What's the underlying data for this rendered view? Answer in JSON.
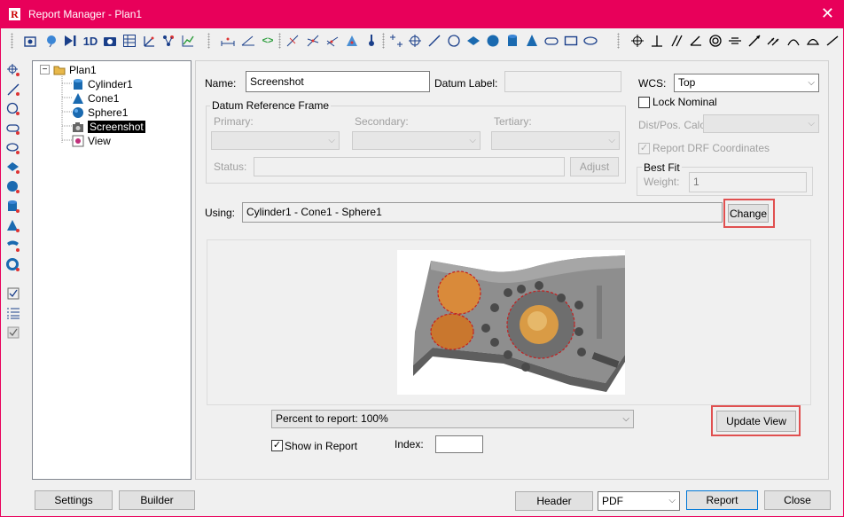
{
  "window": {
    "title": "Report Manager - Plan1",
    "close_glyph": "✕"
  },
  "toolbar": {
    "icons": [
      "screenshot-icon",
      "balloon-icon",
      "play-next-icon",
      "one-d-icon",
      "camera-icon",
      "table-icon",
      "axis-icon",
      "nodes-icon",
      "chart-axis-icon",
      "dimension-icon",
      "angle-icon",
      "code-icon",
      "tangent-icon",
      "intersect-icon",
      "midline-icon",
      "cone-point-icon",
      "probe-icon",
      "points-icon",
      "target-icon",
      "line-icon",
      "circle-icon",
      "plane-icon",
      "sphere-icon",
      "cylinder-icon",
      "cone-icon",
      "slot-icon",
      "rectangle-icon",
      "ellipse-icon",
      "position-icon",
      "perpendicular-icon",
      "parallel-icon",
      "angularity-icon",
      "concentricity-icon",
      "symmetry-icon",
      "runout-icon",
      "total-runout-icon",
      "profile-line-icon",
      "profile-surface-icon",
      "flatness-icon"
    ],
    "one_d_label": "1D"
  },
  "left_toolbar": {
    "icons": [
      "point-tool-icon",
      "line-tool-icon",
      "circle-tool-icon",
      "ellipse-tool-icon",
      "slot-tool-icon",
      "plane-tool-icon",
      "sphere-tool-icon",
      "cylinder-tool-icon",
      "cone-tool-icon",
      "surface-tool-icon",
      "torus-tool-icon",
      "checklist-icon",
      "list-icon",
      "report-check-icon"
    ]
  },
  "tree": {
    "root": "Plan1",
    "items": [
      {
        "label": "Cylinder1",
        "icon": "cylinder-icon"
      },
      {
        "label": "Cone1",
        "icon": "cone-icon"
      },
      {
        "label": "Sphere1",
        "icon": "sphere-icon"
      },
      {
        "label": "Screenshot",
        "icon": "camera-icon",
        "selected": true
      },
      {
        "label": "View",
        "icon": "view-icon"
      }
    ],
    "collapse_glyph": "−"
  },
  "form": {
    "name_label": "Name:",
    "name_value": "Screenshot",
    "datum_label": "Datum Label:",
    "datum_value": "",
    "wcs_label": "WCS:",
    "wcs_value": "Top",
    "lock_nominal": "Lock Nominal",
    "dist_pos_calc": "Dist/Pos. Calc:",
    "report_drf": "Report DRF Coordinates",
    "best_fit": "Best Fit",
    "weight_label": "Weight:",
    "weight_value": "1",
    "drf_title": "Datum Reference Frame",
    "primary": "Primary:",
    "secondary": "Secondary:",
    "tertiary": "Tertiary:",
    "status_label": "Status:",
    "adjust": "Adjust",
    "using_label": "Using:",
    "using_value": "Cylinder1 - Cone1 - Sphere1",
    "change": "Change",
    "percent_value": "Percent to report:  100%",
    "update_view": "Update View",
    "show_in_report": "Show in Report",
    "show_in_report_checked": "✓",
    "report_drf_checked": "✓",
    "index_label": "Index:",
    "index_value": ""
  },
  "bottom": {
    "settings": "Settings",
    "builder": "Builder",
    "header": "Header",
    "format_value": "PDF",
    "report": "Report",
    "close": "Close"
  },
  "colors": {
    "accent": "#e8005a",
    "highlight": "#e05050",
    "part_gray": "#8a8a8a",
    "feature_orange": "#d98a3a"
  }
}
